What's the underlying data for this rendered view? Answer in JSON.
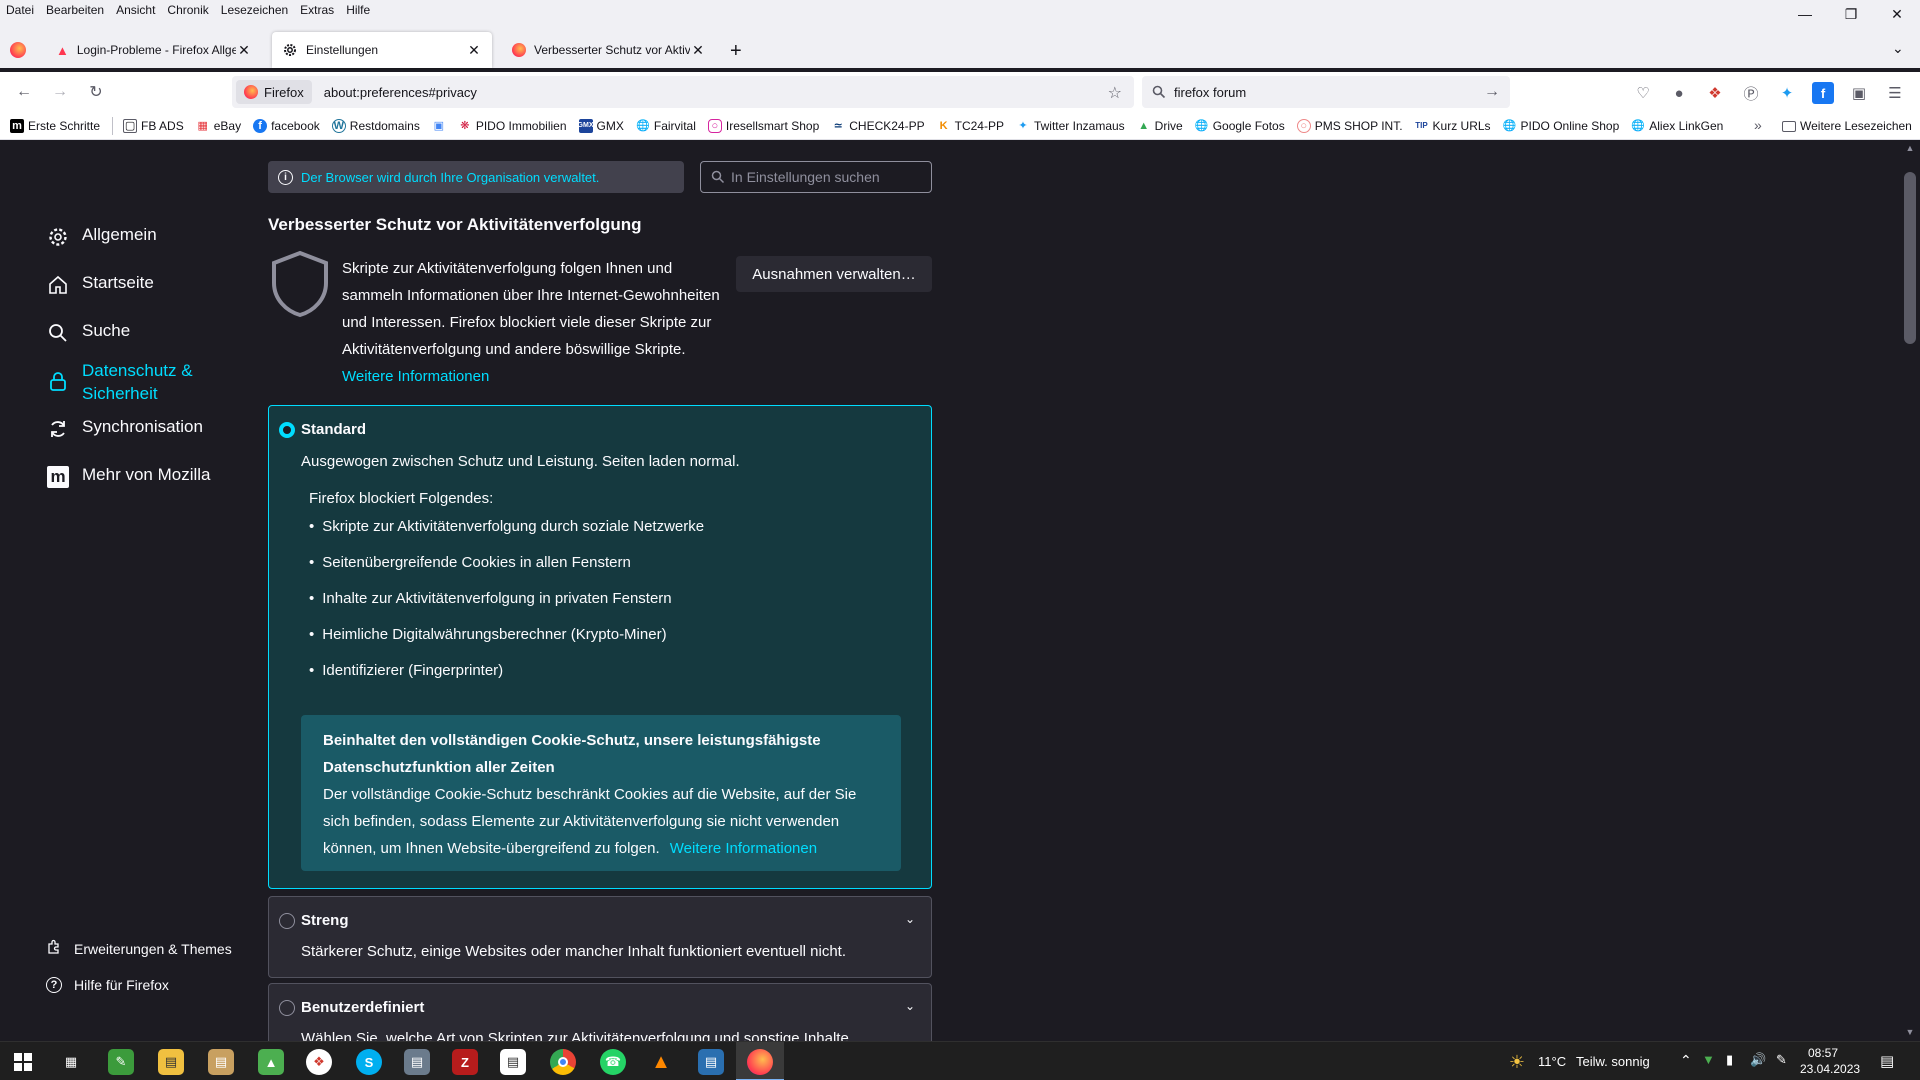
{
  "menubar": {
    "items": [
      "Datei",
      "Bearbeiten",
      "Ansicht",
      "Chronik",
      "Lesezeichen",
      "Extras",
      "Hilfe"
    ]
  },
  "tabs": [
    {
      "title": "Login-Probleme - Firefox Allge",
      "icon": "firefox-support-icon",
      "active": false
    },
    {
      "title": "Einstellungen",
      "icon": "gear-icon",
      "active": true
    },
    {
      "title": "Verbesserter Schutz vor Aktivitä",
      "icon": "firefox-icon",
      "active": false
    }
  ],
  "navbar": {
    "identity_label": "Firefox",
    "url": "about:preferences#privacy",
    "search_value": "firefox forum"
  },
  "bookmarks": [
    "Erste Schritte",
    "FB ADS",
    "eBay",
    "facebook",
    "Restdomains",
    "PIDO Immobilien",
    "GMX",
    "Fairvital",
    "Iresellsmart Shop",
    "CHECK24-PP",
    "TC24-PP",
    "Twitter Inzamaus",
    "Drive",
    "Google Fotos",
    "PMS SHOP INT.",
    "Kurz URLs",
    "PIDO Online Shop",
    "Aliex LinkGen"
  ],
  "bookmarks_other": "Weitere Lesezeichen",
  "policy_banner": "Der Browser wird durch Ihre Organisation verwaltet.",
  "prefs_search_placeholder": "In Einstellungen suchen",
  "sidebar": {
    "categories": [
      {
        "label": "Allgemein",
        "icon": "gear-icon"
      },
      {
        "label": "Startseite",
        "icon": "home-icon"
      },
      {
        "label": "Suche",
        "icon": "search-icon"
      },
      {
        "label": "Datenschutz & Sicherheit",
        "line1": "Datenschutz &",
        "line2": "Sicherheit",
        "icon": "lock-icon",
        "selected": true
      },
      {
        "label": "Synchronisation",
        "icon": "sync-icon"
      },
      {
        "label": "Mehr von Mozilla",
        "icon": "mozilla-icon"
      }
    ],
    "footer": [
      {
        "label": "Erweiterungen & Themes",
        "icon": "puzzle-icon"
      },
      {
        "label": "Hilfe für Firefox",
        "icon": "help-icon"
      }
    ]
  },
  "etp": {
    "title": "Verbesserter Schutz vor Aktivitätenverfolgung",
    "description": "Skripte zur Aktivitätenverfolgung folgen Ihnen und sammeln Informationen über Ihre Internet-Gewohnheiten und Interessen. Firefox blockiert viele dieser Skripte zur Aktivitätenverfolgung und andere böswillige Skripte.",
    "learn_more": "Weitere Informationen",
    "exceptions_button": "Ausnahmen verwalten…"
  },
  "standard": {
    "label": "Standard",
    "description": "Ausgewogen zwischen Schutz und Leistung. Seiten laden normal.",
    "blocks_heading": "Firefox blockiert Folgendes:",
    "blocks": [
      "Skripte zur Aktivitätenverfolgung durch soziale Netzwerke",
      "Seitenübergreifende Cookies in allen Fenstern",
      "Inhalte zur Aktivitätenverfolgung in privaten Fenstern",
      "Heimliche Digitalwährungsberechner (Krypto-Miner)",
      "Identifizierer (Fingerprinter)"
    ],
    "cookie_heading": "Beinhaltet den vollständigen Cookie-Schutz, unsere leistungsfähigste Datenschutzfunktion aller Zeiten",
    "cookie_text": "Der vollständige Cookie-Schutz beschränkt Cookies auf die Website, auf der Sie sich befinden, sodass Elemente zur Aktivitätenverfolgung sie nicht verwenden können, um Ihnen Website-übergreifend zu folgen.",
    "cookie_link": "Weitere Informationen"
  },
  "strict": {
    "label": "Streng",
    "description": "Stärkerer Schutz, einige Websites oder mancher Inhalt funktioniert eventuell nicht."
  },
  "custom": {
    "label": "Benutzerdefiniert",
    "description": "Wählen Sie, welche Art von Skripten zur Aktivitätenverfolgung und sonstige Inhalte"
  },
  "taskbar": {
    "weather_temp": "11°C",
    "weather_text": "Teilw. sonnig",
    "time": "08:57",
    "date": "23.04.2023"
  },
  "colors": {
    "accent": "#00ddff",
    "background": "#1c1b22",
    "selected_box": "#15393f",
    "cookie_box": "#1a5a66"
  }
}
